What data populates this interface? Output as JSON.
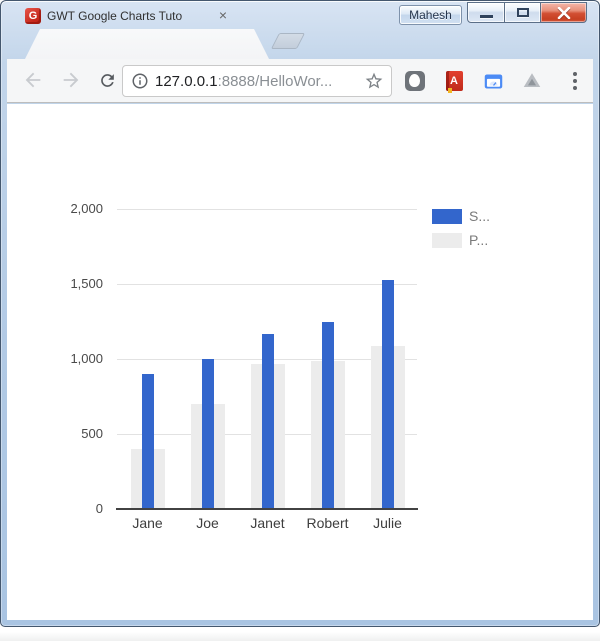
{
  "window": {
    "profile_label": "Mahesh"
  },
  "tab": {
    "favicon_letter": "G",
    "title": "GWT Google Charts Tuto",
    "close_glyph": "×"
  },
  "toolbar": {
    "url": {
      "host": "127.0.0.1",
      "path": ":8888/HelloWor..."
    }
  },
  "chart_data": {
    "type": "bar",
    "title": "",
    "categories": [
      "Jane",
      "Joe",
      "Janet",
      "Robert",
      "Julie"
    ],
    "series": [
      {
        "name": "S...",
        "color": "#3366CC",
        "values": [
          900,
          1000,
          1170,
          1250,
          1530
        ]
      },
      {
        "name": "P...",
        "color": "#ECECEC",
        "values": [
          400,
          700,
          965,
          985,
          1090
        ]
      }
    ],
    "ylim": [
      0,
      2000
    ],
    "yticks": [
      0,
      500,
      1000,
      1500,
      2000
    ],
    "ytick_labels": [
      "0",
      "500",
      "1,000",
      "1,500",
      "2,000"
    ],
    "legend_position": "right",
    "grid": true,
    "axis_color": "#424242",
    "gridline_color": "#E2E2E2"
  }
}
